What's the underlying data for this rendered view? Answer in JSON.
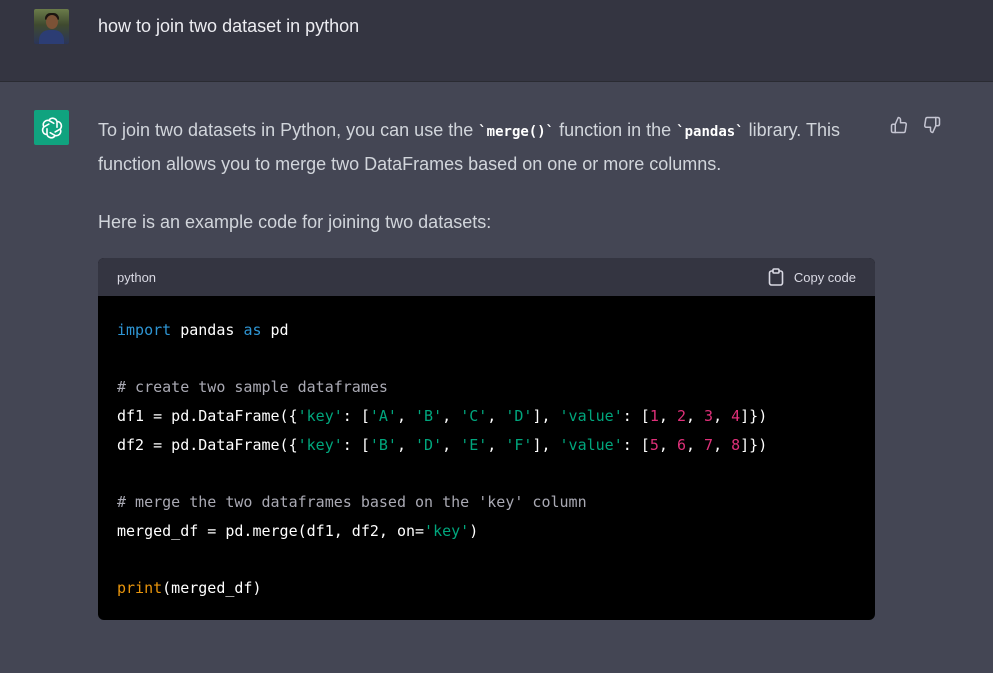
{
  "user": {
    "message": "how to join two dataset in python"
  },
  "assistant": {
    "para1_a": "To join two datasets in Python, you can use the ",
    "para1_code1": "`merge()`",
    "para1_b": " function in the ",
    "para1_code2": "`pandas`",
    "para1_c": " library. This function allows you to merge two DataFrames based on one or more columns.",
    "para2": "Here is an example code for joining two datasets:"
  },
  "code_block": {
    "language": "python",
    "copy_label": "Copy code",
    "lines": {
      "l1_kw1": "import",
      "l1_b": " pandas ",
      "l1_kw2": "as",
      "l1_c": " pd",
      "l3_comment": "# create two sample dataframes",
      "l4_prefix": "df1 = pd.DataFrame({",
      "l5_prefix": "df2 = pd.DataFrame({",
      "key_str": "'key'",
      "value_str": "'value'",
      "df1_keys": [
        "'A'",
        "'B'",
        "'C'",
        "'D'"
      ],
      "df1_values": [
        "1",
        "2",
        "3",
        "4"
      ],
      "df2_keys": [
        "'B'",
        "'D'",
        "'E'",
        "'F'"
      ],
      "df2_values": [
        "5",
        "6",
        "7",
        "8"
      ],
      "l7_comment": "# merge the two dataframes based on the 'key' column",
      "l8_prefix": "merged_df = pd.merge(df1, df2, on=",
      "l8_str": "'key'",
      "l8_suffix": ")",
      "l10_fn": "print",
      "l10_rest": "(merged_df)"
    }
  },
  "icons": {
    "avatar": "user-avatar",
    "bot": "openai-logo-icon",
    "thumbs_up": "thumbs-up-icon",
    "thumbs_down": "thumbs-down-icon",
    "clipboard": "clipboard-icon"
  },
  "colors": {
    "background": "#444654",
    "user_row": "#343541",
    "bot_accent": "#10a37f",
    "code_bg": "#000000",
    "keyword": "#2e95d3",
    "string": "#00a67d",
    "number": "#df3079",
    "builtin": "#e9950c",
    "comment": "#a9a9b3"
  }
}
